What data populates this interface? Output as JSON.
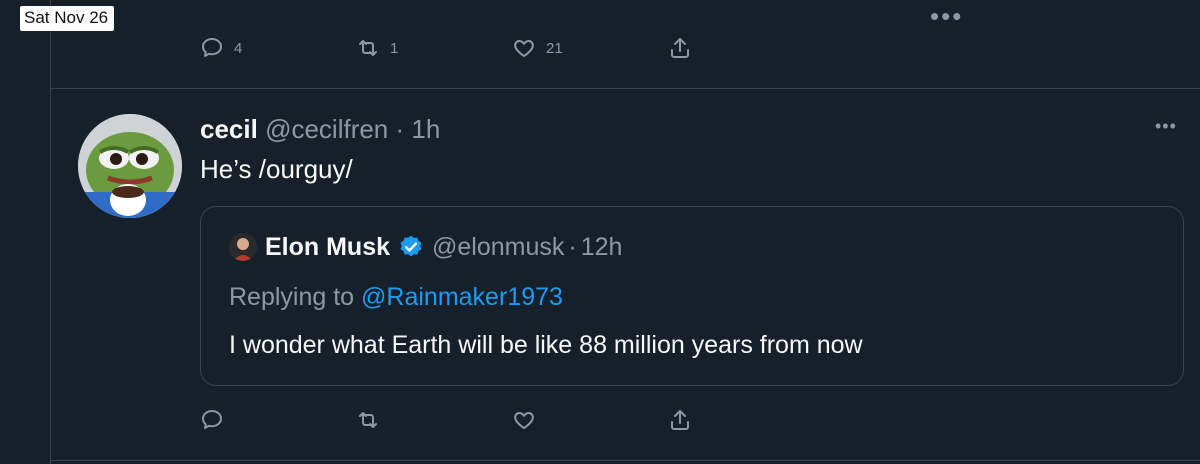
{
  "status_bar": {
    "date": "Sat Nov 26",
    "top_dots": "•••"
  },
  "previous_tweet": {
    "actions": {
      "reply_count": "4",
      "retweet_count": "1",
      "like_count": "21"
    }
  },
  "tweet": {
    "name": "cecil",
    "handle": "@cecilfren",
    "separator": "·",
    "time": "1h",
    "text": "He’s /ourguy/",
    "more": "•••",
    "quote": {
      "name": "Elon Musk",
      "handle": "@elonmusk",
      "separator": "·",
      "time": "12h",
      "replying_prefix": "Replying to",
      "replying_mention": "@Rainmaker1973",
      "text": "I wonder what Earth will be like 88 million years from now"
    }
  },
  "colors": {
    "background": "#15202b",
    "text_primary": "#f7f9f9",
    "text_secondary": "#8b98a5",
    "accent": "#1d9bf0",
    "border": "#38444d"
  }
}
